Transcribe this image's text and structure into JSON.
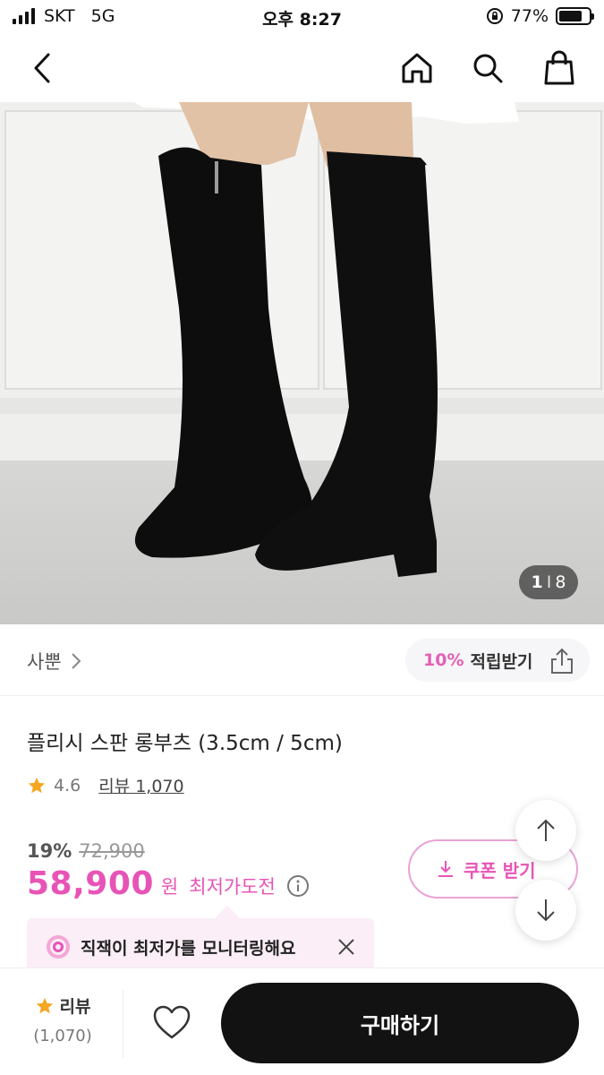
{
  "status_bar": {
    "carrier": "SKT",
    "network": "5G",
    "time": "오후 8:27",
    "battery_percent": "77%",
    "battery_level": 0.77
  },
  "nav": {
    "icons": [
      "back-arrow-icon",
      "home-icon",
      "search-icon",
      "shopping-bag-icon"
    ]
  },
  "hero": {
    "page_current": "1",
    "page_separator": "I",
    "page_total": "8"
  },
  "brand": {
    "name": "사뿐",
    "points_rate": "10%",
    "points_label": "적립받기"
  },
  "product": {
    "title": "플리시 스판 롱부츠 (3.5cm / 5cm)",
    "rating": "4.6",
    "review_link": "리뷰 1,070",
    "discount_rate": "19%",
    "original_price": "72,900",
    "price": "58,900",
    "currency": "원",
    "price_challenge": "최저가도전",
    "coupon_label": "쿠폰 받기",
    "monitor_tip": "직잭이 최저가를 모니터링해요"
  },
  "bottom_bar": {
    "review_label": "리뷰",
    "review_count": "(1,070)",
    "buy_label": "구매하기"
  },
  "colors": {
    "accent": "#e754b6",
    "star": "#f5a623",
    "buy_button": "#121212"
  }
}
